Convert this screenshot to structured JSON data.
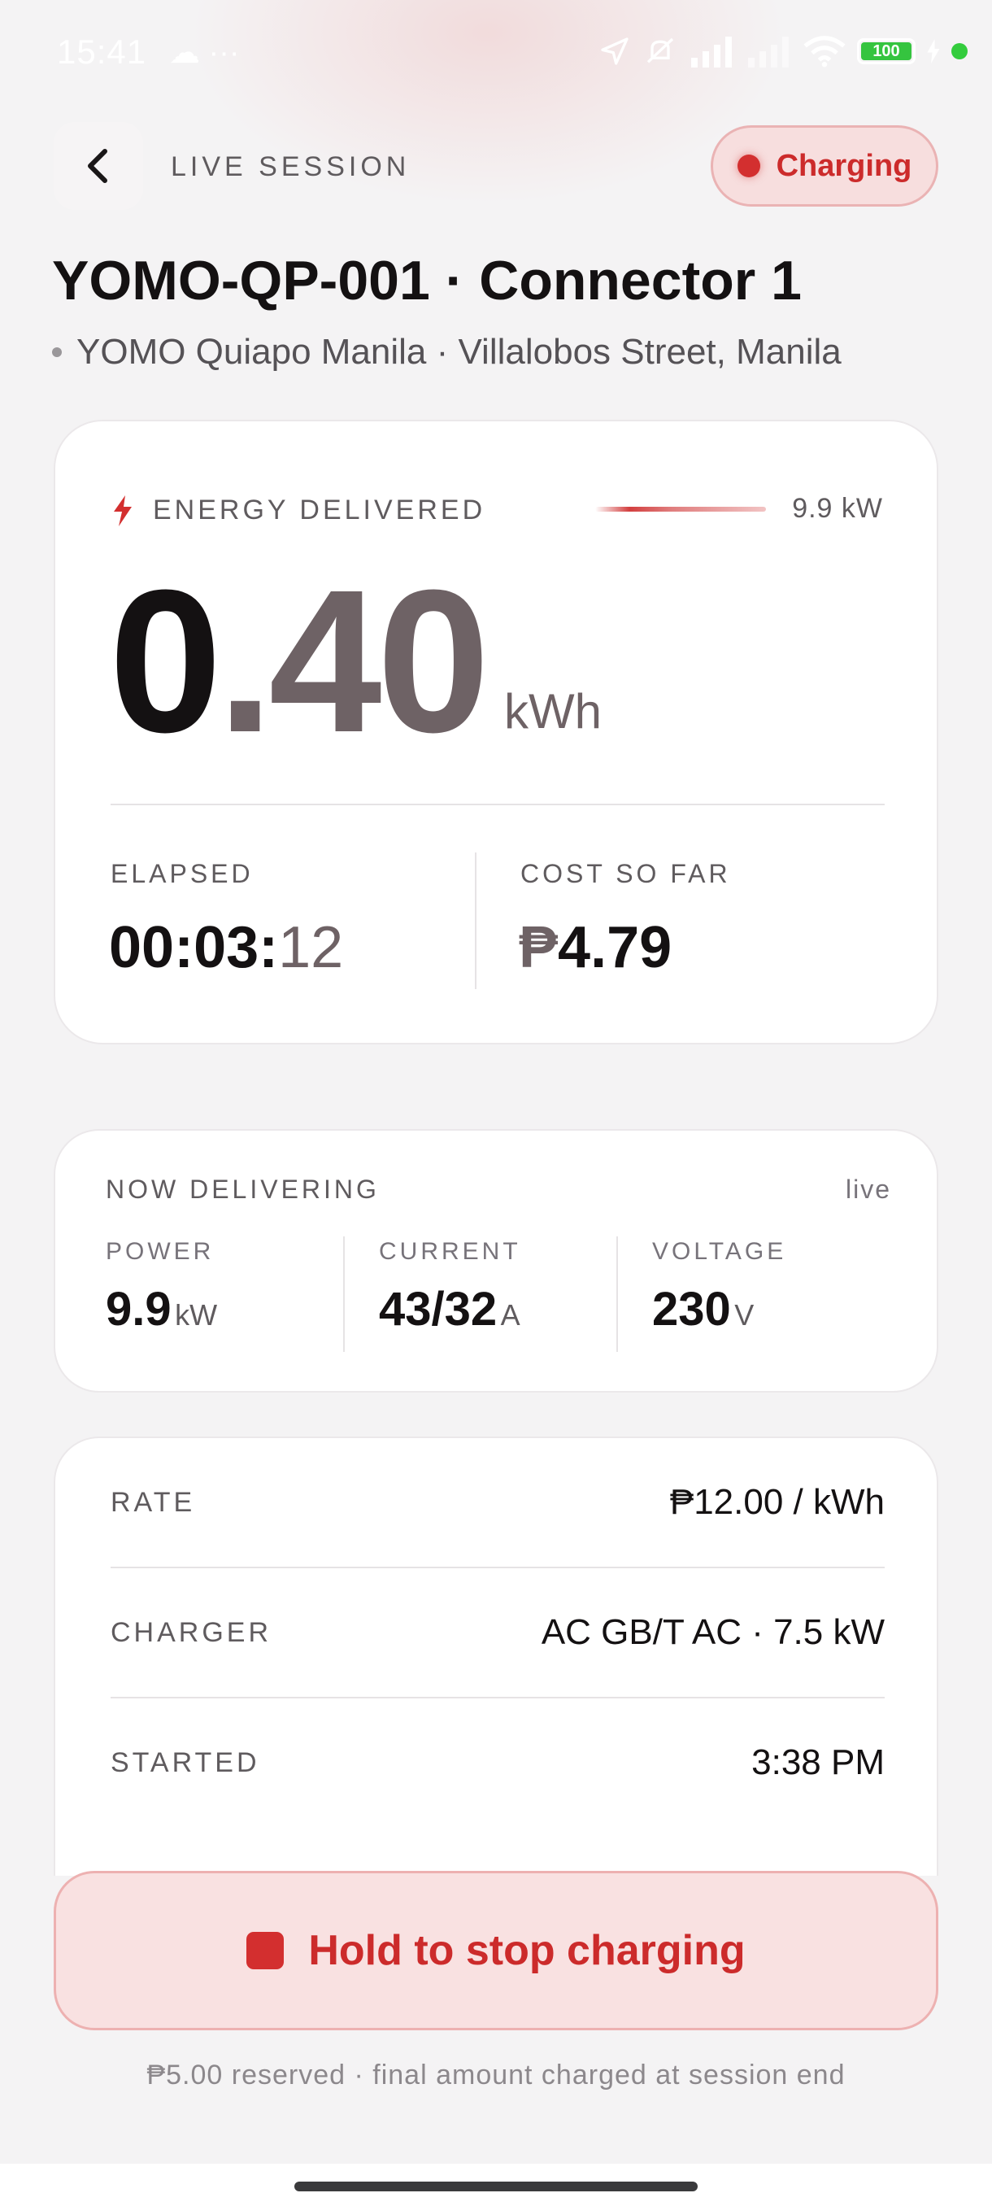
{
  "status_bar": {
    "time": "15:41",
    "left_icons": "☁ ···",
    "battery": "100"
  },
  "header": {
    "back_icon": "chevron-left-icon",
    "label": "LIVE SESSION",
    "status": "Charging"
  },
  "session": {
    "title": "YOMO-QP-001 · Connector 1",
    "location": "YOMO Quiapo Manila · Villalobos Street, Manila"
  },
  "energy": {
    "label": "ENERGY DELIVERED",
    "power": "9.9 kW",
    "value_int": "0",
    "value_dot": ".",
    "value_frac": "40",
    "unit": "kWh",
    "elapsed_label": "ELAPSED",
    "elapsed_main": "00:03:",
    "elapsed_secs": "12",
    "cost_label": "COST SO FAR",
    "cost_currency": "₱",
    "cost_amount": "4.79"
  },
  "delivering": {
    "title": "NOW DELIVERING",
    "live": "live",
    "metrics": [
      {
        "label": "POWER",
        "value": "9.9",
        "unit": "kW"
      },
      {
        "label": "CURRENT",
        "value": "43/32",
        "unit": "A"
      },
      {
        "label": "VOLTAGE",
        "value": "230",
        "unit": "V"
      }
    ]
  },
  "details": [
    {
      "label": "RATE",
      "value": "₱12.00 / kWh"
    },
    {
      "label": "CHARGER",
      "value": "AC GB/T AC · 7.5 kW"
    },
    {
      "label": "STARTED",
      "value": "3:38 PM"
    }
  ],
  "stop_button": {
    "label": "Hold to stop charging"
  },
  "footnote": "₱5.00 reserved · final amount charged at session end",
  "colors": {
    "accent": "#d32f2f",
    "background": "#f4f3f4",
    "card": "#ffffff"
  }
}
